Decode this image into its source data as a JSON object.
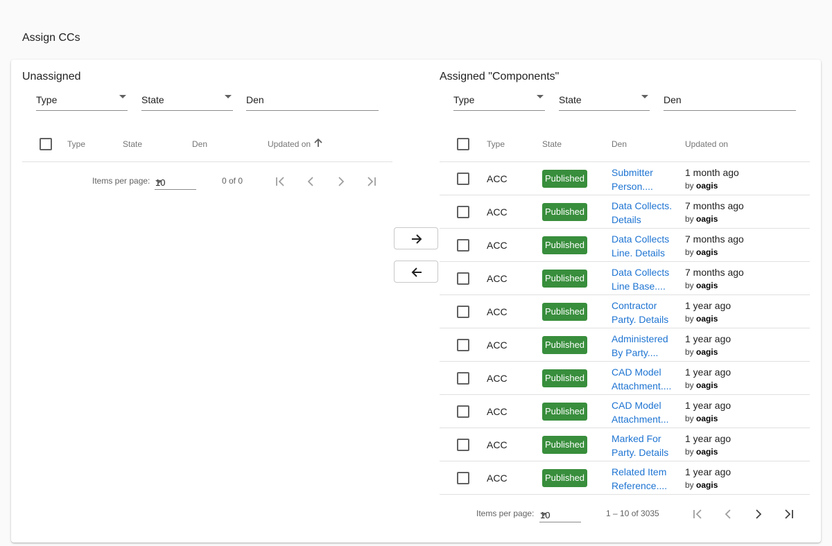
{
  "page_title": "Assign CCs",
  "unassigned": {
    "title": "Unassigned",
    "filters": {
      "type": "Type",
      "state": "State",
      "den": "Den"
    },
    "columns": {
      "type": "Type",
      "state": "State",
      "den": "Den",
      "updated": "Updated on"
    },
    "paginator": {
      "items_per_page_label": "Items per page:",
      "page_size": "10",
      "range": "0 of 0"
    }
  },
  "assigned": {
    "title": "Assigned \"Components\"",
    "filters": {
      "type": "Type",
      "state": "State",
      "den": "Den"
    },
    "columns": {
      "type": "Type",
      "state": "State",
      "den": "Den",
      "updated": "Updated on"
    },
    "rows": [
      {
        "type": "ACC",
        "state": "Published",
        "den1": "Submitter",
        "den2": "Person....",
        "when": "1 month ago",
        "by_prefix": "by",
        "by": "oagis"
      },
      {
        "type": "ACC",
        "state": "Published",
        "den1": "Data Collects.",
        "den2": "Details",
        "when": "7 months ago",
        "by_prefix": "by",
        "by": "oagis"
      },
      {
        "type": "ACC",
        "state": "Published",
        "den1": "Data Collects",
        "den2": "Line. Details",
        "when": "7 months ago",
        "by_prefix": "by",
        "by": "oagis"
      },
      {
        "type": "ACC",
        "state": "Published",
        "den1": "Data Collects",
        "den2": "Line Base....",
        "when": "7 months ago",
        "by_prefix": "by",
        "by": "oagis"
      },
      {
        "type": "ACC",
        "state": "Published",
        "den1": "Contractor",
        "den2": "Party. Details",
        "when": "1 year ago",
        "by_prefix": "by",
        "by": "oagis"
      },
      {
        "type": "ACC",
        "state": "Published",
        "den1": "Administered",
        "den2": "By Party....",
        "when": "1 year ago",
        "by_prefix": "by",
        "by": "oagis"
      },
      {
        "type": "ACC",
        "state": "Published",
        "den1": "CAD Model",
        "den2": "Attachment....",
        "when": "1 year ago",
        "by_prefix": "by",
        "by": "oagis"
      },
      {
        "type": "ACC",
        "state": "Published",
        "den1": "CAD Model",
        "den2": "Attachment...",
        "when": "1 year ago",
        "by_prefix": "by",
        "by": "oagis"
      },
      {
        "type": "ACC",
        "state": "Published",
        "den1": "Marked For",
        "den2": "Party. Details",
        "when": "1 year ago",
        "by_prefix": "by",
        "by": "oagis"
      },
      {
        "type": "ACC",
        "state": "Published",
        "den1": "Related Item",
        "den2": "Reference....",
        "when": "1 year ago",
        "by_prefix": "by",
        "by": "oagis"
      }
    ],
    "paginator": {
      "items_per_page_label": "Items per page:",
      "page_size": "10",
      "range": "1 – 10 of 3035"
    }
  },
  "colors": {
    "published_badge": "#388e3c",
    "link": "#1e74d2"
  },
  "icons": {
    "assign": "arrow-right-icon",
    "unassign": "arrow-left-icon",
    "sort": "arrow-up-icon"
  }
}
